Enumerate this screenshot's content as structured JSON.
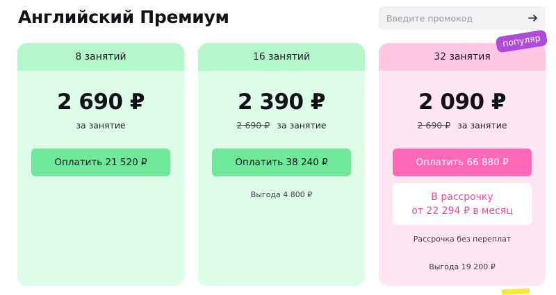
{
  "page": {
    "title": "Английский Премиум"
  },
  "promo": {
    "placeholder": "Введите промокод"
  },
  "plans": [
    {
      "lessons": "8 занятий",
      "price": "2 690 ₽",
      "old_price": "",
      "per_label": "за занятие",
      "pay_label": "Оплатить 21 520 ₽",
      "benefit": ""
    },
    {
      "lessons": "16 занятий",
      "price": "2 390 ₽",
      "old_price": "2 690 ₽",
      "per_label": "за занятие",
      "pay_label": "Оплатить 38 240 ₽",
      "benefit": "Выгода 4 800 ₽"
    },
    {
      "lessons": "32 занятия",
      "price": "2 090 ₽",
      "old_price": "2 690 ₽",
      "per_label": "за занятие",
      "pay_label": "Оплатить 66 880 ₽",
      "badge": "популяр",
      "installment_line1": "В рассрочку",
      "installment_line2": "от 22 294 ₽ в месяц",
      "installment_note": "Рассрочка без переплат",
      "benefit": "Выгода 19 200 ₽"
    }
  ],
  "colors": {
    "green_head": "#b3f7cb",
    "green_bg": "#ddfde8",
    "green_button": "#6fe89a",
    "pink_head": "#ffc7e2",
    "pink_bg": "#ffe6f2",
    "pink_button": "#ff69b8",
    "badge": "#b04ad8",
    "installment_text": "#e94aa3"
  }
}
